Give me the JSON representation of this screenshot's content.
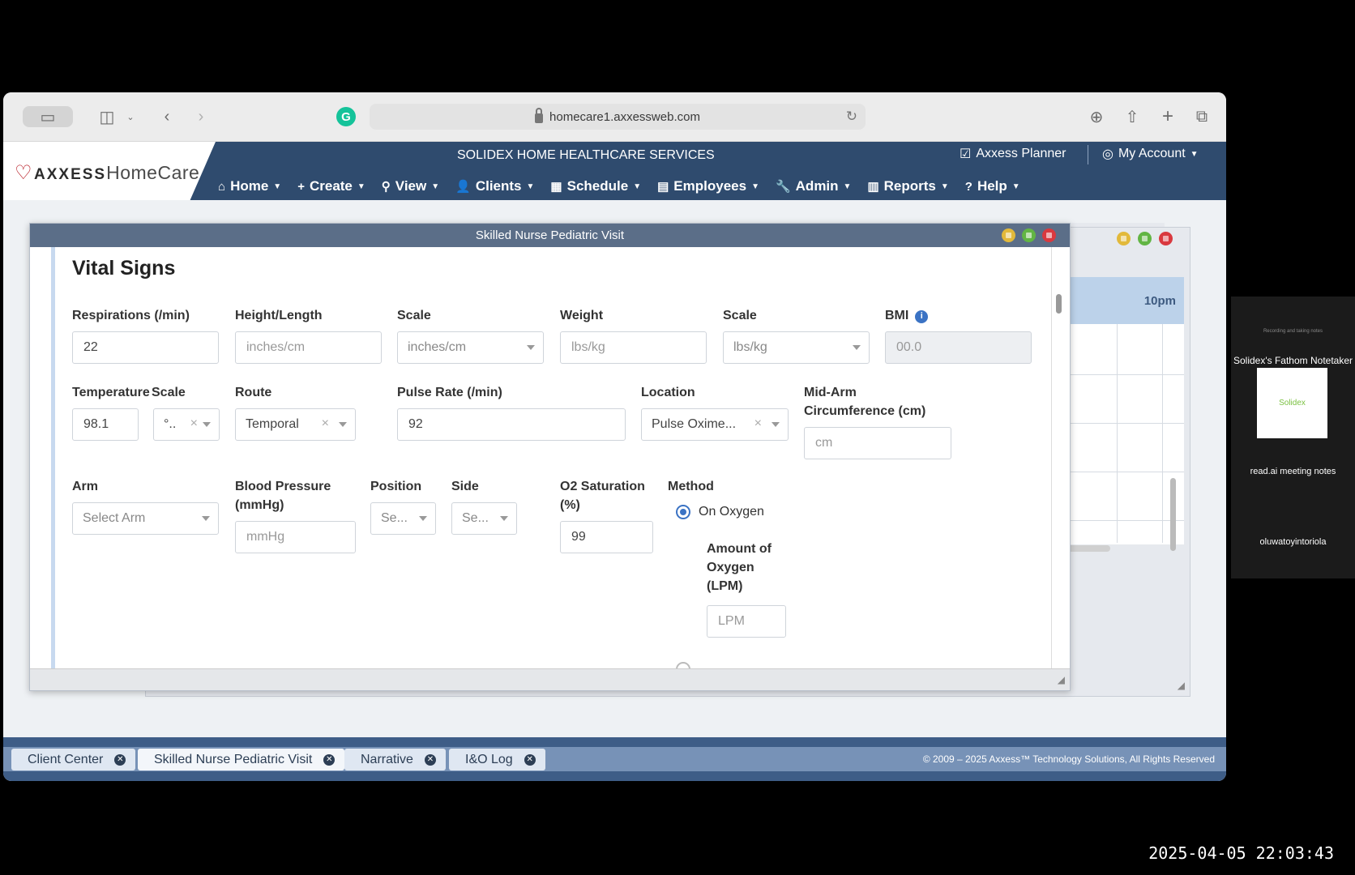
{
  "browser": {
    "url": "homecare1.axxessweb.com"
  },
  "app": {
    "logo_brand": "AXXESS",
    "logo_product": "HomeCare",
    "agency": "SOLIDEX HOME HEALTHCARE SERVICES",
    "planner": "Axxess Planner",
    "account": "My Account",
    "nav": [
      {
        "label": "Home",
        "icon": "home-icon"
      },
      {
        "label": "Create",
        "icon": "plus-icon"
      },
      {
        "label": "View",
        "icon": "search-icon"
      },
      {
        "label": "Clients",
        "icon": "user-icon"
      },
      {
        "label": "Schedule",
        "icon": "calendar-icon"
      },
      {
        "label": "Employees",
        "icon": "id-card-icon"
      },
      {
        "label": "Admin",
        "icon": "wrench-icon"
      },
      {
        "label": "Reports",
        "icon": "bar-chart-icon"
      },
      {
        "label": "Help",
        "icon": "question-icon"
      }
    ]
  },
  "background_window": {
    "time_label": "10pm"
  },
  "modal": {
    "title": "Skilled Nurse Pediatric Visit",
    "section": "Vital Signs",
    "fields": {
      "respirations": {
        "label": "Respirations (/min)",
        "value": "22"
      },
      "height": {
        "label": "Height/Length",
        "placeholder": "inches/cm"
      },
      "height_scale": {
        "label": "Scale",
        "value": "inches/cm"
      },
      "weight": {
        "label": "Weight",
        "placeholder": "lbs/kg"
      },
      "weight_scale": {
        "label": "Scale",
        "value": "lbs/kg"
      },
      "bmi": {
        "label": "BMI",
        "placeholder": "00.0"
      },
      "temperature": {
        "label": "Temperature",
        "value": "98.1"
      },
      "temp_scale": {
        "label": "Scale",
        "value": "°.."
      },
      "route": {
        "label": "Route",
        "value": "Temporal"
      },
      "pulse": {
        "label": "Pulse Rate (/min)",
        "value": "92"
      },
      "location": {
        "label": "Location",
        "value": "Pulse Oxime..."
      },
      "mid_arm": {
        "label_line1": "Mid-Arm",
        "label_line2": "Circumference (cm)",
        "placeholder": "cm"
      },
      "arm": {
        "label": "Arm",
        "value": "Select Arm"
      },
      "bp": {
        "label_line1": "Blood Pressure",
        "label_line2": "(mmHg)",
        "placeholder": "mmHg"
      },
      "position": {
        "label": "Position",
        "value": "Se..."
      },
      "side": {
        "label": "Side",
        "value": "Se..."
      },
      "o2": {
        "label_line1": "O2 Saturation",
        "label_line2": "(%)",
        "value": "99"
      },
      "method": {
        "label": "Method",
        "option_on_oxygen": "On Oxygen"
      },
      "oxygen_amount": {
        "label_line1": "Amount of",
        "label_line2": "Oxygen",
        "label_line3": "(LPM)",
        "placeholder": "LPM"
      }
    }
  },
  "taskbar": {
    "tabs": [
      "Client Center",
      "Skilled Nurse Pediatric Visit",
      "Narrative",
      "I&O Log"
    ],
    "copyright": "© 2009 – 2025 Axxess™ Technology Solutions, All Rights Reserved"
  },
  "side_panel": {
    "recording_note": "Recording and taking notes",
    "participant1": "Solidex's Fathom Notetaker",
    "tile_text": "Solidex",
    "participant2": "read.ai meeting notes",
    "participant3": "oluwatoyintoriola"
  },
  "timestamp": "2025-04-05 22:03:43",
  "colors": {
    "header": "#2f4b6e",
    "modal_title": "#5b6e88",
    "accent": "#3b73c4",
    "taskbar": "#3e5d87"
  }
}
